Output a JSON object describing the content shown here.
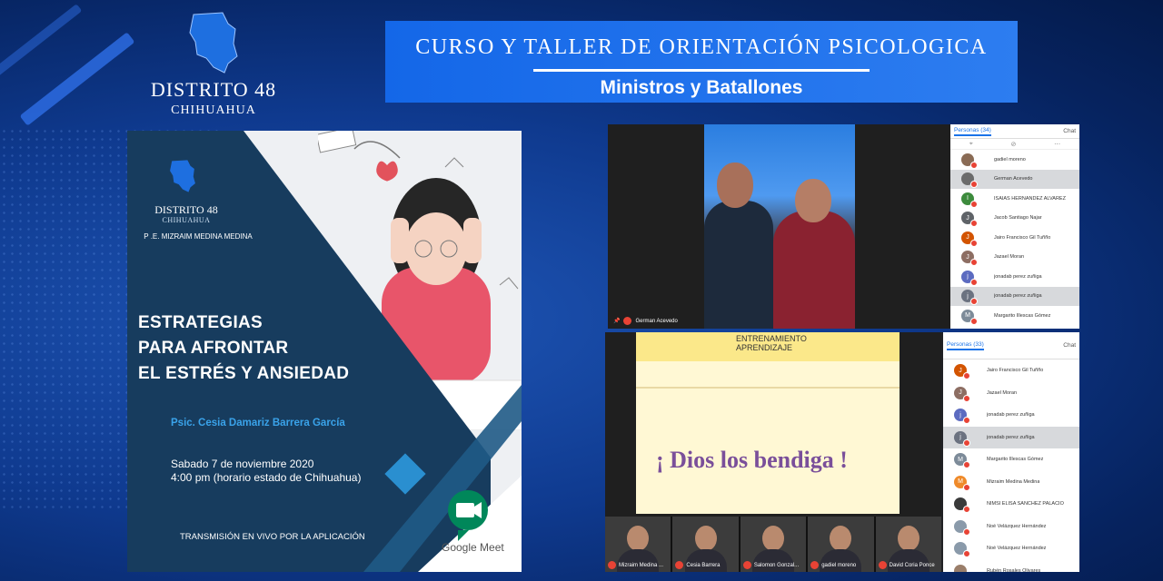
{
  "header": {
    "logo_title": "DISTRITO 48",
    "logo_subtitle": "CHIHUAHUA",
    "banner_title": "CURSO Y TALLER DE ORIENTACIÓN PSICOLOGICA",
    "banner_subtitle": "Ministros y Batallones"
  },
  "poster": {
    "district": "DISTRITO 48",
    "district_sub": "CHIHUAHUA",
    "pastor": "P .E. MIZRAIM MEDINA MEDINA",
    "title_lines": [
      "ESTRATEGIAS",
      "PARA AFRONTAR",
      "EL ESTRÉS Y ANSIEDAD"
    ],
    "speaker": "Psic. Cesia Damariz Barrera García",
    "date": "Sabado 7 de noviembre 2020",
    "time": "4:00 pm (horario estado de Chihuahua)",
    "transmission": "TRANSMISIÓN EN VIVO POR LA APLICACIÓN",
    "app_name": "Google Meet"
  },
  "meet1": {
    "speaker_label": "German Acevedo",
    "people_tab": "Personas (34)",
    "chat_tab": "Chat",
    "participants": [
      {
        "initial": "",
        "name": "gadiel moreno",
        "color": "#8a6b55",
        "selected": false
      },
      {
        "initial": "",
        "name": "German Acevedo",
        "color": "#6b6b6b",
        "selected": true
      },
      {
        "initial": "I",
        "name": "ISAIAS HERNANDEZ ALVAREZ",
        "color": "#3d8b3d",
        "selected": false
      },
      {
        "initial": "J",
        "name": "Jacob Santiago Najar",
        "color": "#5f6368",
        "selected": false
      },
      {
        "initial": "J",
        "name": "Jairo Francisco Gil Tuñño",
        "color": "#d35400",
        "selected": false
      },
      {
        "initial": "J",
        "name": "Jazael Moran",
        "color": "#8d6e63",
        "selected": false
      },
      {
        "initial": "j",
        "name": "jonadab perez zuñiga",
        "color": "#5c6bc0",
        "selected": false
      },
      {
        "initial": "j",
        "name": "jonadab perez zuñiga",
        "color": "#6b7280",
        "selected": true
      },
      {
        "initial": "M",
        "name": "Margarito Illescas Gómez",
        "color": "#7d8b99",
        "selected": false
      }
    ]
  },
  "meet2": {
    "slide_header_1": "ENTRENAMIENTO",
    "slide_header_2": "APRENDIZAJE",
    "slide_text": "¡ Dios los bendiga !",
    "people_tab": "Personas (33)",
    "chat_tab": "Chat",
    "tiles": [
      "Mizraim Medina ...",
      "Cesia Barrera",
      "Salomon Gonzal...",
      "gadiel moreno",
      "David Coria Ponce"
    ],
    "participants": [
      {
        "initial": "J",
        "name": "Jairo Francisco Gil Tuñño",
        "color": "#d35400",
        "selected": false
      },
      {
        "initial": "J",
        "name": "Jazael Moran",
        "color": "#8d6e63",
        "selected": false
      },
      {
        "initial": "j",
        "name": "jonadab perez zuñiga",
        "color": "#5c6bc0",
        "selected": false
      },
      {
        "initial": "j",
        "name": "jonadab perez zuñiga",
        "color": "#6b7280",
        "selected": true
      },
      {
        "initial": "M",
        "name": "Margarito Illescas Gómez",
        "color": "#7d8b99",
        "selected": false
      },
      {
        "initial": "M",
        "name": "Mizraim Medina Medina",
        "color": "#ef8a2a",
        "selected": false
      },
      {
        "initial": "",
        "name": "NIMSI ELISA SANCHEZ PALACIO",
        "color": "#3a3a3a",
        "selected": false
      },
      {
        "initial": "",
        "name": "Noé Velázquez Hernández",
        "color": "#8a9aaa",
        "selected": false
      },
      {
        "initial": "",
        "name": "Noé Velázquez Hernández",
        "color": "#8a9aaa",
        "selected": false
      },
      {
        "initial": "",
        "name": "Rubén Rosales Olivares",
        "color": "#9a7e6a",
        "selected": false
      }
    ]
  }
}
